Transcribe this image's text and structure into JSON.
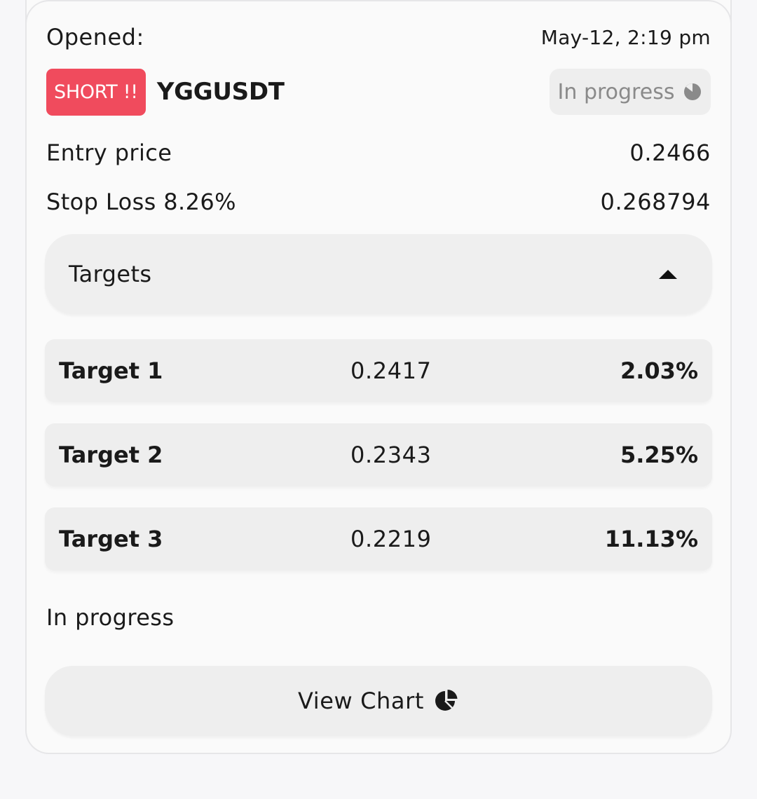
{
  "signal": {
    "opened_label": "Opened:",
    "opened_date": "May-12, 2:19 pm",
    "direction_badge": "SHORT !!",
    "pair": "YGGUSDT",
    "status": "In progress",
    "status_icon": "pie-progress-icon",
    "entry_label": "Entry price",
    "entry_value": "0.2466",
    "stop_loss_label": "Stop Loss 8.26%",
    "stop_loss_value": "0.268794"
  },
  "targets": {
    "title": "Targets",
    "toggle_icon": "caret-up-icon",
    "items": [
      {
        "name": "Target 1",
        "price": "0.2417",
        "percent": "2.03%"
      },
      {
        "name": "Target 2",
        "price": "0.2343",
        "percent": "5.25%"
      },
      {
        "name": "Target 3",
        "price": "0.2219",
        "percent": "11.13%"
      }
    ]
  },
  "footer": {
    "progress_text": "In progress",
    "view_chart_label": "View Chart",
    "view_chart_icon": "pie-chart-icon"
  },
  "colors": {
    "short_badge": "#f04b5d",
    "chip_bg": "#eeeeee",
    "page_bg": "#f7f7f9"
  }
}
